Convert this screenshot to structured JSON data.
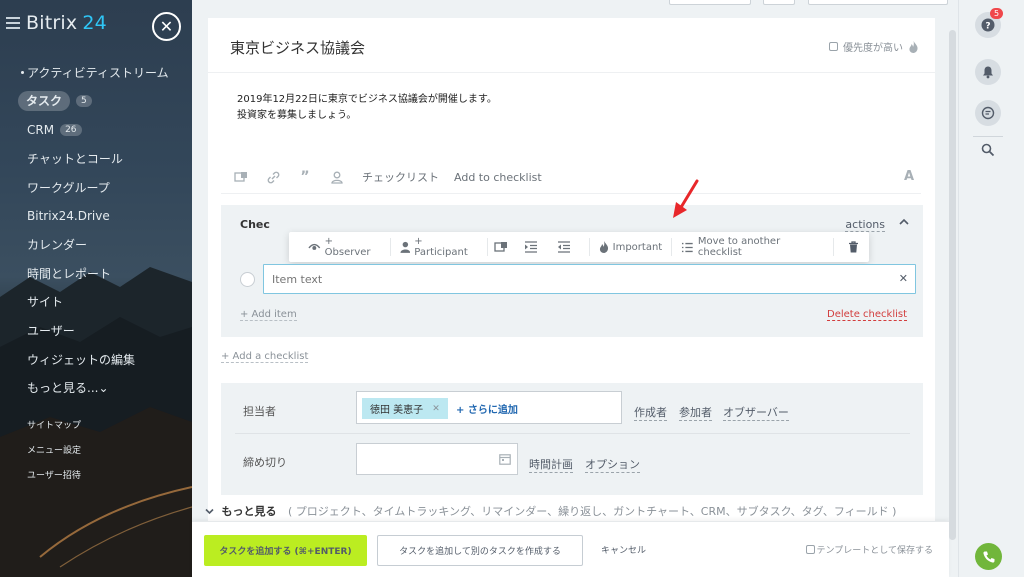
{
  "sidebar": {
    "logo_text": "Bitrix",
    "logo_num": "24",
    "items": [
      {
        "label": "アクティビティストリーム"
      },
      {
        "label": "タスク",
        "badge": "5"
      },
      {
        "label": "CRM",
        "badge": "26"
      },
      {
        "label": "チャットとコール"
      },
      {
        "label": "ワークグループ"
      },
      {
        "label": "Bitrix24.Drive"
      },
      {
        "label": "カレンダー"
      },
      {
        "label": "時間とレポート"
      },
      {
        "label": "サイト"
      },
      {
        "label": "ユーザー"
      },
      {
        "label": "ウィジェットの編集"
      },
      {
        "label": "もっと見る...⌄"
      }
    ],
    "small_links": [
      "サイトマップ",
      "メニュー設定",
      "ユーザー招待"
    ]
  },
  "rail": {
    "help_badge": "5"
  },
  "task": {
    "title": "東京ビジネス協議会",
    "priority_label": "優先度が高い",
    "description_line1": "2019年12月22日に東京でビジネス協議会が開催します。",
    "description_line2": "投資家を募集しましょう。"
  },
  "toolbar": {
    "checklist_label": "チェックリスト",
    "add_to_checklist": "Add to checklist",
    "font_label": "A"
  },
  "checklist": {
    "title": "Chec",
    "actions_label": "actions",
    "item_placeholder": "Item text",
    "add_item": "+ Add item",
    "delete_checklist": "Delete checklist",
    "add_checklist": "+ Add a checklist",
    "popup": {
      "observer": "+ Observer",
      "participant": "+ Participant",
      "important": "Important",
      "move": "Move to another checklist"
    }
  },
  "fields": {
    "responsible_label": "担当者",
    "responsible_chip": "徳田 美恵子",
    "add_more": "+ さらに追加",
    "roles": [
      "作成者",
      "参加者",
      "オブザーバー"
    ],
    "deadline_label": "締め切り",
    "time_planning": "時間計画",
    "options": "オプション"
  },
  "more": {
    "label": "もっと見る",
    "details": "( プロジェクト、タイムトラッキング、リマインダー、繰り返し、ガントチャート、CRM、サブタスク、タグ、フィールド )"
  },
  "footer": {
    "add_task": "タスクを追加する (⌘+ENTER)",
    "add_and_create": "タスクを追加して別のタスクを作成する",
    "cancel": "キャンセル",
    "save_template": "テンプレートとして保存する"
  },
  "colors": {
    "accent_green": "#bbed21",
    "link_blue": "#2067b0",
    "danger_red": "#d23d3d",
    "arrow_red": "#e8272a"
  }
}
